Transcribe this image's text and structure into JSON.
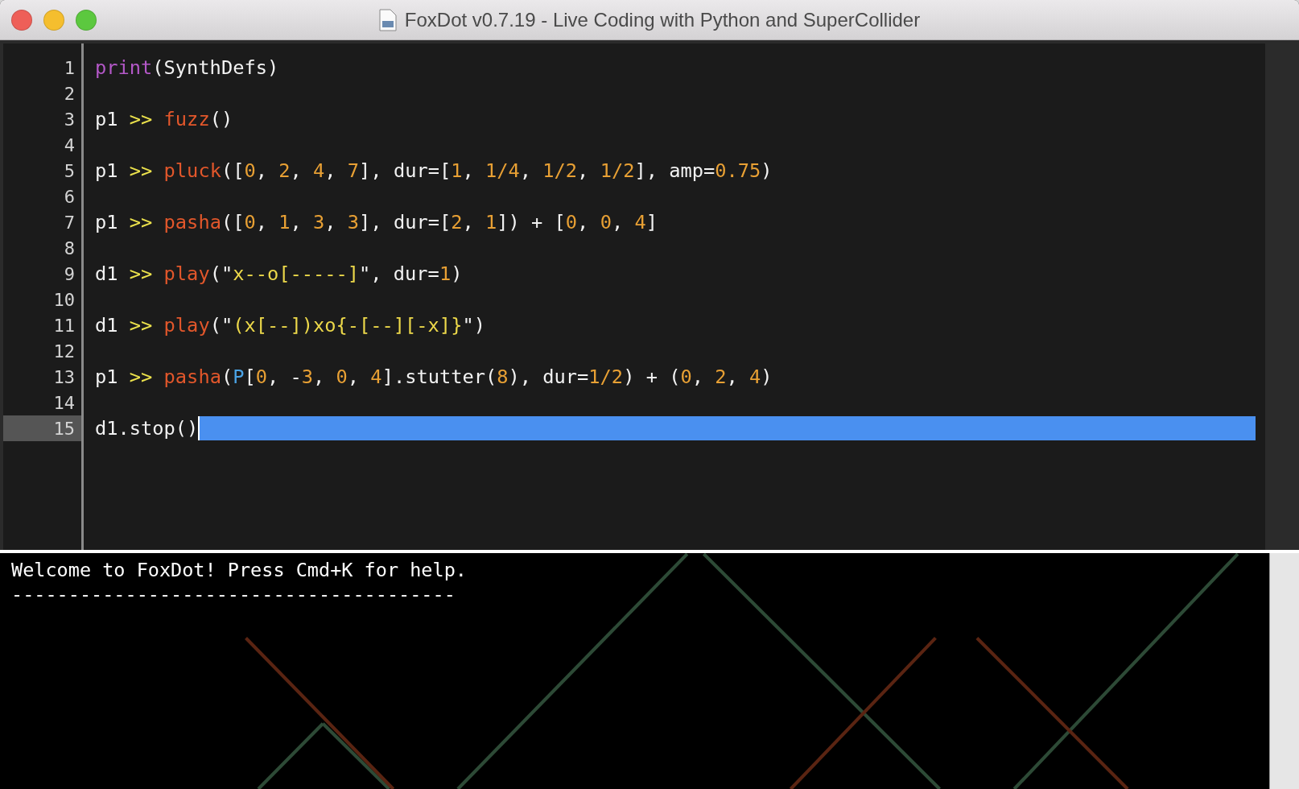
{
  "window": {
    "title": "FoxDot v0.7.19 - Live Coding with Python and SuperCollider"
  },
  "editor": {
    "lines": [
      {
        "number": "1",
        "selected": false,
        "tokens": [
          {
            "kind": "keyword",
            "text": "print"
          },
          {
            "kind": "plain",
            "text": "(SynthDefs)"
          }
        ]
      },
      {
        "number": "2",
        "selected": false
      },
      {
        "number": "3",
        "selected": false,
        "tokens": [
          {
            "kind": "plain",
            "text": "p1 "
          },
          {
            "kind": "op",
            "text": ">> "
          },
          {
            "kind": "func",
            "text": "fuzz"
          },
          {
            "kind": "plain",
            "text": "()"
          }
        ]
      },
      {
        "number": "4",
        "selected": false
      },
      {
        "number": "5",
        "selected": false,
        "tokens": [
          {
            "kind": "plain",
            "text": "p1 "
          },
          {
            "kind": "op",
            "text": ">> "
          },
          {
            "kind": "func",
            "text": "pluck"
          },
          {
            "kind": "plain",
            "text": "(["
          },
          {
            "kind": "num",
            "text": "0"
          },
          {
            "kind": "plain",
            "text": ", "
          },
          {
            "kind": "num",
            "text": "2"
          },
          {
            "kind": "plain",
            "text": ", "
          },
          {
            "kind": "num",
            "text": "4"
          },
          {
            "kind": "plain",
            "text": ", "
          },
          {
            "kind": "num",
            "text": "7"
          },
          {
            "kind": "plain",
            "text": "], dur=["
          },
          {
            "kind": "num",
            "text": "1"
          },
          {
            "kind": "plain",
            "text": ", "
          },
          {
            "kind": "num",
            "text": "1/4"
          },
          {
            "kind": "plain",
            "text": ", "
          },
          {
            "kind": "num",
            "text": "1/2"
          },
          {
            "kind": "plain",
            "text": ", "
          },
          {
            "kind": "num",
            "text": "1/2"
          },
          {
            "kind": "plain",
            "text": "], amp="
          },
          {
            "kind": "num",
            "text": "0.75"
          },
          {
            "kind": "plain",
            "text": ")"
          }
        ]
      },
      {
        "number": "6",
        "selected": false
      },
      {
        "number": "7",
        "selected": false,
        "tokens": [
          {
            "kind": "plain",
            "text": "p1 "
          },
          {
            "kind": "op",
            "text": ">> "
          },
          {
            "kind": "func",
            "text": "pasha"
          },
          {
            "kind": "plain",
            "text": "(["
          },
          {
            "kind": "num",
            "text": "0"
          },
          {
            "kind": "plain",
            "text": ", "
          },
          {
            "kind": "num",
            "text": "1"
          },
          {
            "kind": "plain",
            "text": ", "
          },
          {
            "kind": "num",
            "text": "3"
          },
          {
            "kind": "plain",
            "text": ", "
          },
          {
            "kind": "num",
            "text": "3"
          },
          {
            "kind": "plain",
            "text": "], dur=["
          },
          {
            "kind": "num",
            "text": "2"
          },
          {
            "kind": "plain",
            "text": ", "
          },
          {
            "kind": "num",
            "text": "1"
          },
          {
            "kind": "plain",
            "text": "]) + ["
          },
          {
            "kind": "num",
            "text": "0"
          },
          {
            "kind": "plain",
            "text": ", "
          },
          {
            "kind": "num",
            "text": "0"
          },
          {
            "kind": "plain",
            "text": ", "
          },
          {
            "kind": "num",
            "text": "4"
          },
          {
            "kind": "plain",
            "text": "]"
          }
        ]
      },
      {
        "number": "8",
        "selected": false
      },
      {
        "number": "9",
        "selected": false,
        "tokens": [
          {
            "kind": "plain",
            "text": "d1 "
          },
          {
            "kind": "op",
            "text": ">> "
          },
          {
            "kind": "func",
            "text": "play"
          },
          {
            "kind": "plain",
            "text": "(\""
          },
          {
            "kind": "str",
            "text": "x--o[-----]"
          },
          {
            "kind": "plain",
            "text": "\", dur="
          },
          {
            "kind": "num",
            "text": "1"
          },
          {
            "kind": "plain",
            "text": ")"
          }
        ]
      },
      {
        "number": "10",
        "selected": false
      },
      {
        "number": "11",
        "selected": false,
        "tokens": [
          {
            "kind": "plain",
            "text": "d1 "
          },
          {
            "kind": "op",
            "text": ">> "
          },
          {
            "kind": "func",
            "text": "play"
          },
          {
            "kind": "plain",
            "text": "(\""
          },
          {
            "kind": "str",
            "text": "(x[--])xo{-[--][-x]}"
          },
          {
            "kind": "plain",
            "text": "\")"
          }
        ]
      },
      {
        "number": "12",
        "selected": false
      },
      {
        "number": "13",
        "selected": false,
        "tokens": [
          {
            "kind": "plain",
            "text": "p1 "
          },
          {
            "kind": "op",
            "text": ">> "
          },
          {
            "kind": "func",
            "text": "pasha"
          },
          {
            "kind": "plain",
            "text": "("
          },
          {
            "kind": "class",
            "text": "P"
          },
          {
            "kind": "plain",
            "text": "["
          },
          {
            "kind": "num",
            "text": "0"
          },
          {
            "kind": "plain",
            "text": ", -"
          },
          {
            "kind": "num",
            "text": "3"
          },
          {
            "kind": "plain",
            "text": ", "
          },
          {
            "kind": "num",
            "text": "0"
          },
          {
            "kind": "plain",
            "text": ", "
          },
          {
            "kind": "num",
            "text": "4"
          },
          {
            "kind": "plain",
            "text": "].stutter("
          },
          {
            "kind": "num",
            "text": "8"
          },
          {
            "kind": "plain",
            "text": "), dur="
          },
          {
            "kind": "num",
            "text": "1/2"
          },
          {
            "kind": "plain",
            "text": ") + ("
          },
          {
            "kind": "num",
            "text": "0"
          },
          {
            "kind": "plain",
            "text": ", "
          },
          {
            "kind": "num",
            "text": "2"
          },
          {
            "kind": "plain",
            "text": ", "
          },
          {
            "kind": "num",
            "text": "4"
          },
          {
            "kind": "plain",
            "text": ")"
          }
        ]
      },
      {
        "number": "14",
        "selected": false
      },
      {
        "number": "15",
        "selected": true,
        "tokens": [
          {
            "kind": "plain",
            "text": "d1.stop()"
          }
        ]
      }
    ]
  },
  "console": {
    "lines": [
      "Welcome to FoxDot! Press Cmd+K for help.",
      "---------------------------------------"
    ]
  }
}
